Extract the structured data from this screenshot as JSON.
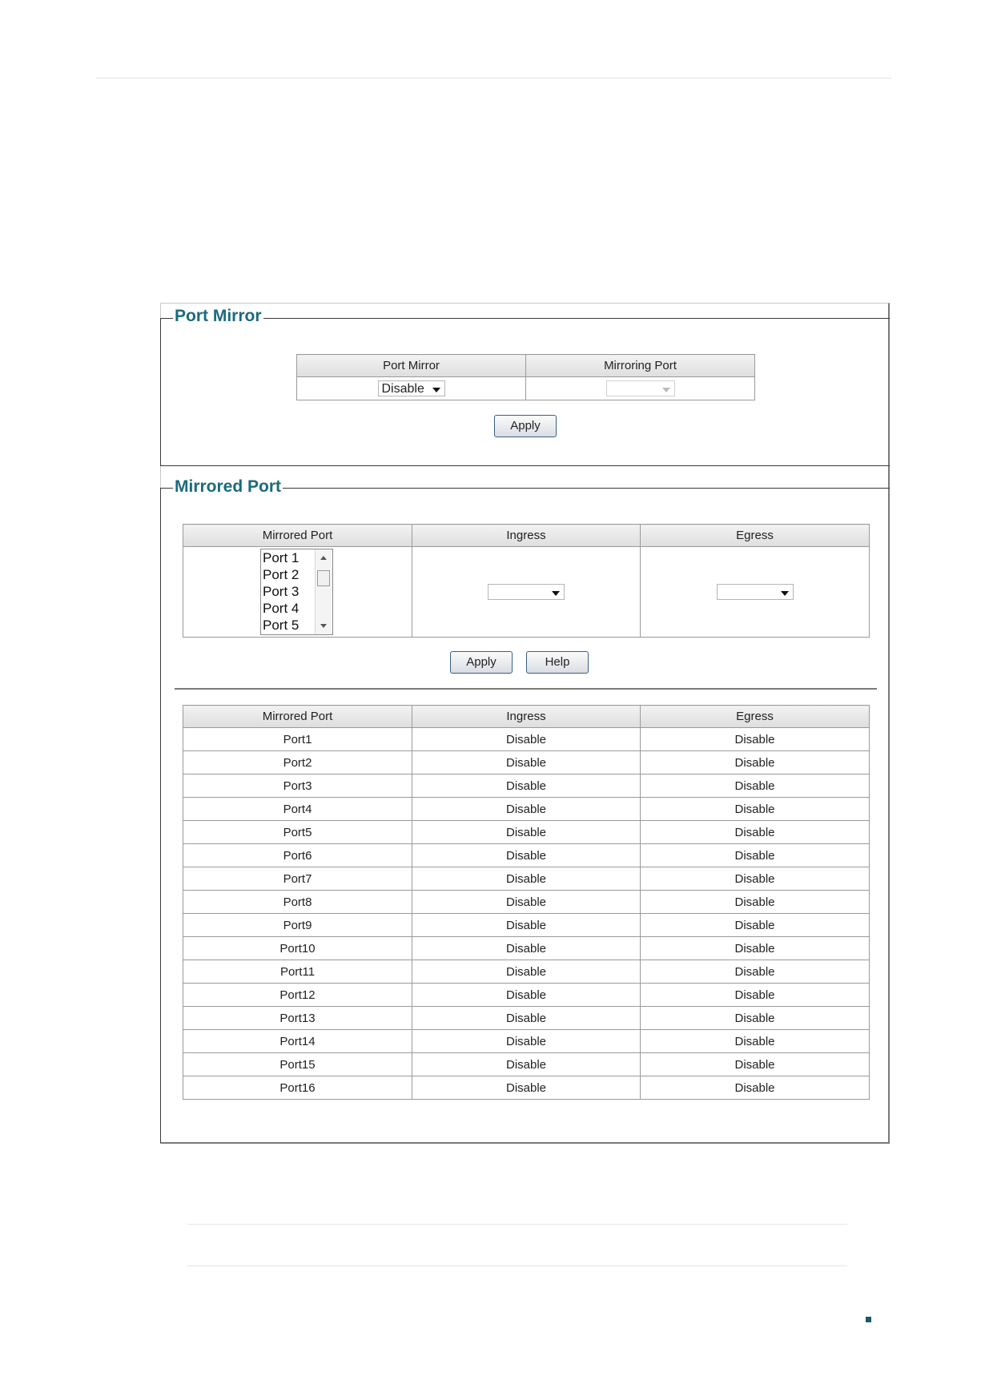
{
  "port_mirror": {
    "title": "Port Mirror",
    "table": {
      "headers": [
        "Port Mirror",
        "Mirroring Port"
      ],
      "port_mirror_value": "Disable",
      "mirroring_port_value": ""
    },
    "apply_label": "Apply"
  },
  "mirrored_port": {
    "title": "Mirrored Port",
    "config_table": {
      "headers": [
        "Mirrored Port",
        "Ingress",
        "Egress"
      ],
      "port_options": [
        "Port 1",
        "Port 2",
        "Port 3",
        "Port 4",
        "Port 5"
      ],
      "ingress_value": "",
      "egress_value": ""
    },
    "apply_label": "Apply",
    "help_label": "Help",
    "status_table": {
      "headers": [
        "Mirrored Port",
        "Ingress",
        "Egress"
      ],
      "rows": [
        [
          "Port1",
          "Disable",
          "Disable"
        ],
        [
          "Port2",
          "Disable",
          "Disable"
        ],
        [
          "Port3",
          "Disable",
          "Disable"
        ],
        [
          "Port4",
          "Disable",
          "Disable"
        ],
        [
          "Port5",
          "Disable",
          "Disable"
        ],
        [
          "Port6",
          "Disable",
          "Disable"
        ],
        [
          "Port7",
          "Disable",
          "Disable"
        ],
        [
          "Port8",
          "Disable",
          "Disable"
        ],
        [
          "Port9",
          "Disable",
          "Disable"
        ],
        [
          "Port10",
          "Disable",
          "Disable"
        ],
        [
          "Port11",
          "Disable",
          "Disable"
        ],
        [
          "Port12",
          "Disable",
          "Disable"
        ],
        [
          "Port13",
          "Disable",
          "Disable"
        ],
        [
          "Port14",
          "Disable",
          "Disable"
        ],
        [
          "Port15",
          "Disable",
          "Disable"
        ],
        [
          "Port16",
          "Disable",
          "Disable"
        ]
      ]
    }
  }
}
